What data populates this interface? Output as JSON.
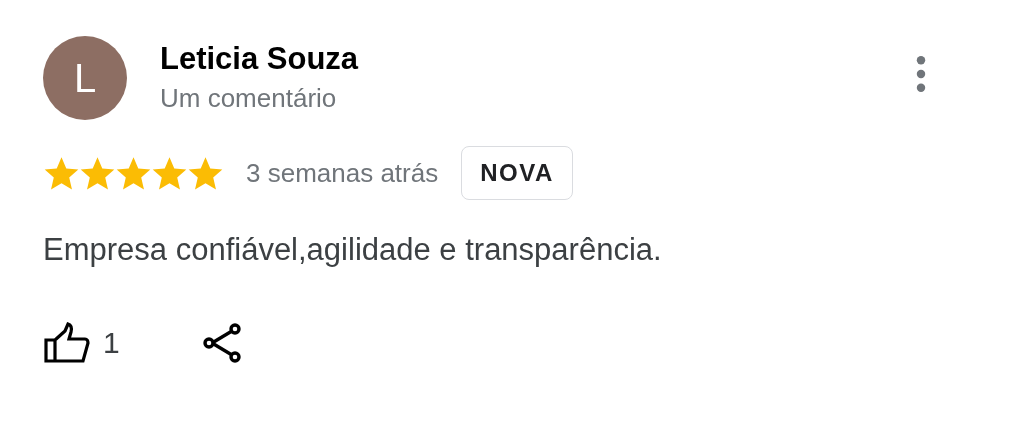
{
  "review": {
    "avatar_letter": "L",
    "author": "Leticia Souza",
    "subtitle": "Um comentário",
    "stars": 5,
    "time": "3 semanas atrás",
    "badge": "NOVA",
    "text": "Empresa confiável,agilidade e transparência.",
    "likes": "1"
  }
}
